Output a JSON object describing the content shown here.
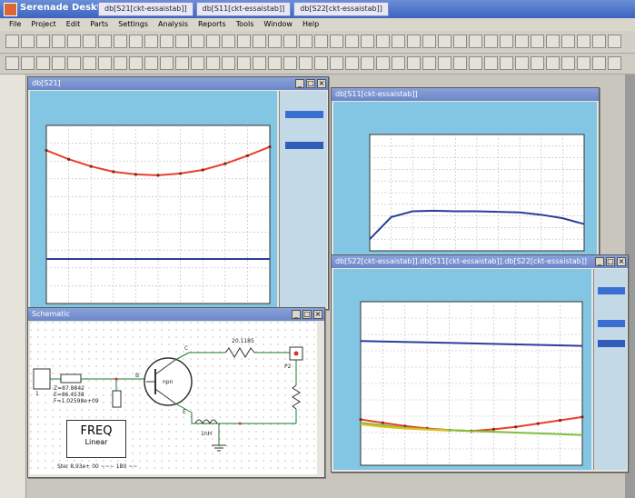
{
  "app": {
    "title": "Serenade Desktop",
    "tabs": [
      "db[S21[ckt-essaistab]]",
      "db[S11[ckt-essaistab]]",
      "db[S22[ckt-essaistab]]"
    ]
  },
  "menu": [
    "File",
    "Project",
    "Edit",
    "Parts",
    "Settings",
    "Analysis",
    "Reports",
    "Tools",
    "Window",
    "Help"
  ],
  "windows": {
    "plot_left": {
      "title": "db[S21]"
    },
    "plot_top_right": {
      "title": "db[S11[ckt-essaistab]]"
    },
    "plot_bottom_right": {
      "title": "db[S22[ckt-essaistab]].db[S11[ckt-essaistab]].db[S22[ckt-essaistab]]"
    },
    "schematic": {
      "title": "Schematic"
    }
  },
  "schematic": {
    "freq_label": "FREQ",
    "freq_sub": "Linear",
    "resistor_value": "20.1185",
    "inductor_label": "1nH",
    "npn_label": "npn",
    "pin_left": "1",
    "pin_right": "P2",
    "node_c": "C",
    "node_b": "B",
    "node_e": "E",
    "freq_params": [
      "Z=87.8842",
      "E=86.4538",
      "F=1.02598e+09"
    ],
    "bottom_note": "Ster 8.93e+ 00 ~~~ 1B0 ~~"
  },
  "colors": {
    "titlebar": "#3b64c0",
    "plot_bg": "#83c6e3",
    "trace_red": "#e8402a",
    "trace_blue": "#2a3f9a",
    "trace_green": "#7fbf3a",
    "trace_yellow": "#e0c020"
  },
  "chart_data": [
    {
      "type": "line",
      "title": "",
      "series": [
        {
          "color": "#e8402a",
          "x": [
            0,
            1,
            2,
            3,
            4,
            5,
            6,
            7,
            8,
            9,
            10
          ],
          "values": [
            8.6,
            8.1,
            7.7,
            7.4,
            7.25,
            7.2,
            7.3,
            7.5,
            7.85,
            8.3,
            8.8
          ]
        },
        {
          "color": "#2a3f9a",
          "x": [
            0,
            10
          ],
          "values": [
            2.5,
            2.5
          ]
        }
      ],
      "xlim": [
        0,
        10
      ],
      "ylim": [
        0,
        10
      ],
      "grid": true
    },
    {
      "type": "line",
      "title": "",
      "series": [
        {
          "color": "#2a3f9a",
          "x": [
            0,
            1,
            2,
            3,
            4,
            5,
            6,
            7,
            8,
            9,
            10
          ],
          "values": [
            1.0,
            2.9,
            3.4,
            3.45,
            3.4,
            3.4,
            3.35,
            3.3,
            3.1,
            2.8,
            2.3
          ]
        }
      ],
      "xlim": [
        0,
        10
      ],
      "ylim": [
        0,
        10
      ],
      "grid": true
    },
    {
      "type": "line",
      "title": "",
      "series": [
        {
          "color": "#2a3f9a",
          "x": [
            0,
            10
          ],
          "values": [
            7.6,
            7.3
          ]
        },
        {
          "color": "#e8402a",
          "x": [
            0,
            1,
            2,
            3,
            4,
            5,
            6,
            7,
            8,
            9,
            10
          ],
          "values": [
            2.8,
            2.6,
            2.4,
            2.25,
            2.15,
            2.1,
            2.2,
            2.35,
            2.55,
            2.75,
            2.95
          ]
        },
        {
          "color": "#7fbf3a",
          "x": [
            0,
            1,
            2,
            3,
            4,
            5,
            6,
            7,
            8,
            9,
            10
          ],
          "values": [
            2.6,
            2.45,
            2.3,
            2.2,
            2.15,
            2.1,
            2.05,
            2.0,
            1.95,
            1.9,
            1.85
          ]
        },
        {
          "color": "#e0c020",
          "x": [
            0,
            1,
            2,
            3,
            4
          ],
          "values": [
            2.5,
            2.35,
            2.25,
            2.18,
            2.12
          ]
        }
      ],
      "xlim": [
        0,
        10
      ],
      "ylim": [
        0,
        10
      ],
      "grid": true
    }
  ]
}
